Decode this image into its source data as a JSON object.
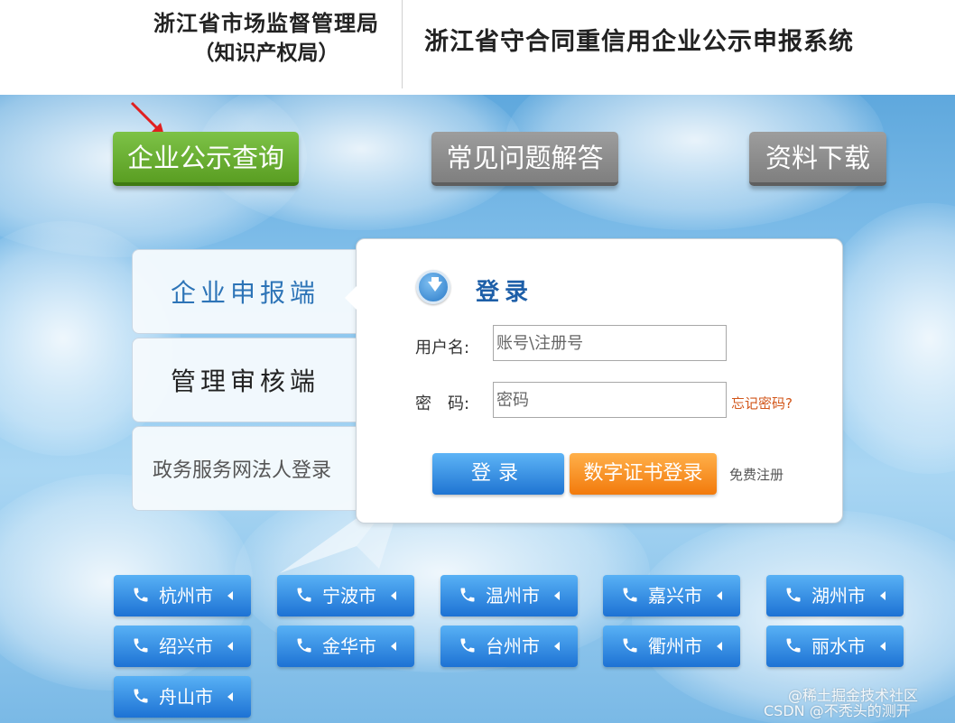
{
  "header": {
    "dept_line1": "浙江省市场监督管理局",
    "dept_line2": "（知识产权局）",
    "system_title": "浙江省守合同重信用企业公示申报系统"
  },
  "nav": {
    "query": "企业公示查询",
    "faq": "常见问题解答",
    "download": "资料下载"
  },
  "tabs": {
    "enterprise": "企业申报端",
    "admin": "管理审核端",
    "gov_login": "政务服务网法人登录"
  },
  "login": {
    "title": "登录",
    "username_label": "用户名:",
    "username_placeholder": "账号\\注册号",
    "password_label": "密　码:",
    "password_placeholder": "密码",
    "forgot": "忘记密码?",
    "login_button": "登录",
    "cert_button": "数字证书登录",
    "register": "免费注册"
  },
  "cities": [
    "杭州市",
    "宁波市",
    "温州市",
    "嘉兴市",
    "湖州市",
    "绍兴市",
    "金华市",
    "台州市",
    "衢州市",
    "丽水市",
    "舟山市"
  ],
  "watermark": {
    "line1": "@稀土掘金技术社区",
    "line2": "CSDN @不秃头的测开"
  },
  "colors": {
    "nav_active": "#5a9e22",
    "nav_inactive": "#8c8c8c",
    "primary_blue": "#1f74d2",
    "cert_orange": "#f27a0c",
    "forgot_link": "#d2561a",
    "title_blue": "#1e5fa8"
  }
}
